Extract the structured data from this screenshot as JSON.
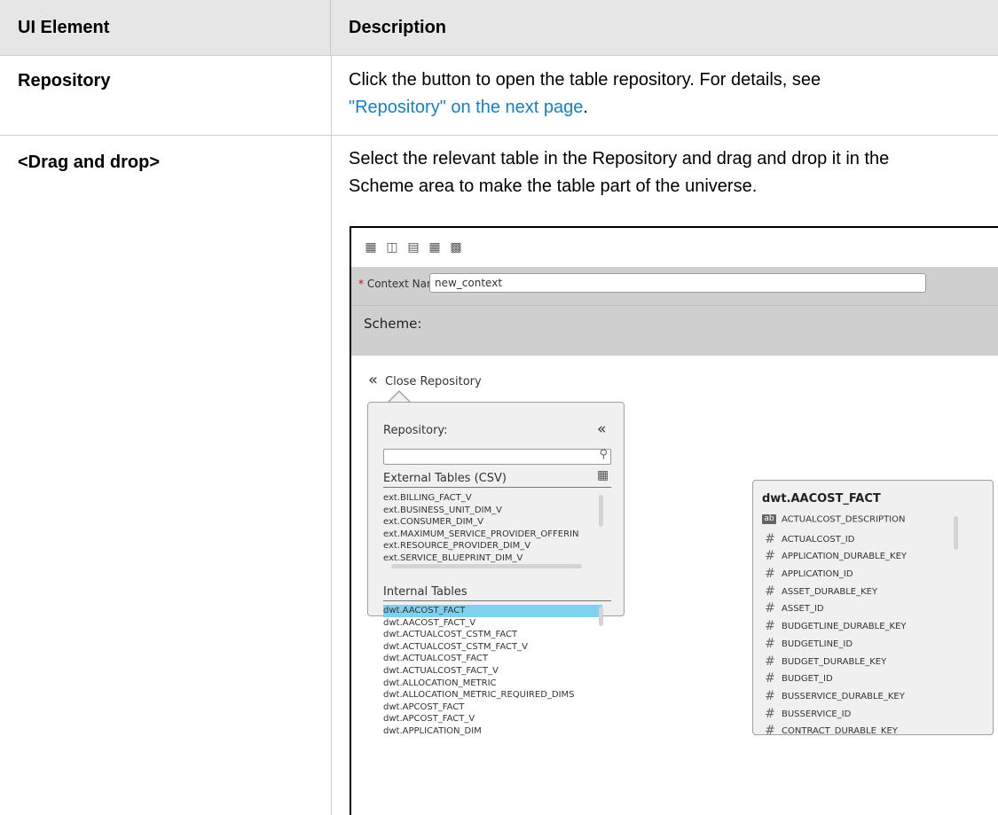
{
  "table": {
    "headers": {
      "element": "UI Element",
      "description": "Description"
    },
    "rows": [
      {
        "element": "Repository",
        "desc_text": "Click the button to open the table repository. For details, see",
        "desc_link": "\"Repository\" on the next page",
        "desc_after": "."
      },
      {
        "element": "<Drag and drop>",
        "desc_line1": "Select the relevant table in the Repository and drag and drop it in the",
        "desc_line2": "Scheme area to make the table part of the universe."
      }
    ]
  },
  "screenshot": {
    "toolbar_icons": [
      "new-icon",
      "save-icon",
      "properties-icon",
      "add-table-icon",
      "validate-icon"
    ],
    "context_label": "Context Name:",
    "context_required_marker": "*",
    "context_value": "new_context",
    "scheme_label": "Scheme:",
    "close_repository_label": "Close Repository",
    "repository": {
      "title": "Repository:",
      "search_placeholder": "",
      "external_section": "External Tables (CSV)",
      "external_tables": [
        "ext.BILLING_FACT_V",
        "ext.BUSINESS_UNIT_DIM_V",
        "ext.CONSUMER_DIM_V",
        "ext.MAXIMUM_SERVICE_PROVIDER_OFFERIN",
        "ext.RESOURCE_PROVIDER_DIM_V",
        "ext.SERVICE_BLUEPRINT_DIM_V"
      ],
      "internal_section": "Internal Tables",
      "internal_tables": [
        "dwt.AACOST_FACT",
        "dwt.AACOST_FACT_V",
        "dwt.ACTUALCOST_CSTM_FACT",
        "dwt.ACTUALCOST_CSTM_FACT_V",
        "dwt.ACTUALCOST_FACT",
        "dwt.ACTUALCOST_FACT_V",
        "dwt.ALLOCATION_METRIC",
        "dwt.ALLOCATION_METRIC_REQUIRED_DIMS",
        "dwt.APCOST_FACT",
        "dwt.APCOST_FACT_V",
        "dwt.APPLICATION_DIM"
      ],
      "selected_internal": "dwt.AACOST_FACT"
    },
    "table_box": {
      "title": "dwt.AACOST_FACT",
      "columns": [
        {
          "type": "ab",
          "name": "ACTUALCOST_DESCRIPTION"
        },
        {
          "type": "#",
          "name": "ACTUALCOST_ID"
        },
        {
          "type": "#",
          "name": "APPLICATION_DURABLE_KEY"
        },
        {
          "type": "#",
          "name": "APPLICATION_ID"
        },
        {
          "type": "#",
          "name": "ASSET_DURABLE_KEY"
        },
        {
          "type": "#",
          "name": "ASSET_ID"
        },
        {
          "type": "#",
          "name": "BUDGETLINE_DURABLE_KEY"
        },
        {
          "type": "#",
          "name": "BUDGETLINE_ID"
        },
        {
          "type": "#",
          "name": "BUDGET_DURABLE_KEY"
        },
        {
          "type": "#",
          "name": "BUDGET_ID"
        },
        {
          "type": "#",
          "name": "BUSSERVICE_DURABLE_KEY"
        },
        {
          "type": "#",
          "name": "BUSSERVICE_ID"
        },
        {
          "type": "#",
          "name": "CONTRACT_DURABLE_KEY"
        }
      ]
    }
  }
}
